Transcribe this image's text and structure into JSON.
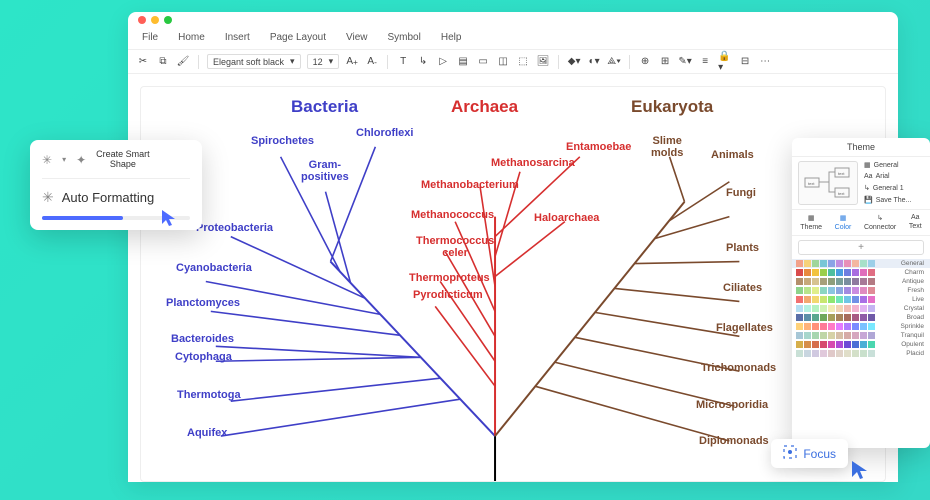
{
  "menus": {
    "file": "File",
    "home": "Home",
    "insert": "Insert",
    "pagelayout": "Page Layout",
    "view": "View",
    "symbol": "Symbol",
    "help": "Help"
  },
  "toolbar": {
    "font_name": "Elegant soft black",
    "font_size": "12"
  },
  "tree": {
    "domains": {
      "bacteria": "Bacteria",
      "archaea": "Archaea",
      "eukaryota": "Eukaryota"
    },
    "bacteria": {
      "spirochetes": "Spirochetes",
      "chloroflexi": "Chloroflexi",
      "gram_positives": "Gram-\npositives",
      "proteobacteria": "Proteobacteria",
      "cyanobacteria": "Cyanobacteria",
      "planctomyces": "Planctomyces",
      "bacteroides": "Bacteroides",
      "cytophaga": "Cytophaga",
      "thermotoga": "Thermotoga",
      "aquifex": "Aquifex"
    },
    "archaea": {
      "methanosarcina": "Methanosarcina",
      "methanobacterium": "Methanobacterium",
      "methanococcus": "Methanococcus",
      "thermococcus": "Thermococcus\nceler",
      "thermoproteus": "Thermoproteus",
      "pyrodicticum": "Pyrodicticum",
      "entamoebae": "Entamoebae",
      "haloarchaea": "Haloarchaea"
    },
    "eukaryota": {
      "slime_molds": "Slime\nmolds",
      "animals": "Animals",
      "fungi": "Fungi",
      "plants": "Plants",
      "ciliates": "Ciliates",
      "flagellates": "Flagellates",
      "trichomonads": "Trichomonads",
      "microsporidia": "Microsporidia",
      "diplomonads": "Diplomonads"
    }
  },
  "popup": {
    "create_smart_shape": "Create Smart\nShape",
    "auto_formatting": "Auto Formatting"
  },
  "theme": {
    "title": "Theme",
    "side": {
      "general": "General",
      "font": "Arial",
      "general1": "General 1",
      "save": "Save The..."
    },
    "tabs": {
      "theme": "Theme",
      "color": "Color",
      "connector": "Connector",
      "text": "Text"
    },
    "palettes": [
      "General",
      "Charm",
      "Antique",
      "Fresh",
      "Live",
      "Crystal",
      "Broad",
      "Sprinkle",
      "Tranquil",
      "Opulent",
      "Placid"
    ],
    "swatches": [
      [
        "#f2a28b",
        "#f6d27a",
        "#9fd69b",
        "#79c6d6",
        "#8aa3e6",
        "#c08ee0",
        "#e88fb8",
        "#f3b6a0",
        "#a7e0c9",
        "#9ccfe8"
      ],
      [
        "#d94b4b",
        "#e8893d",
        "#f2c33d",
        "#9bcf4b",
        "#4fbf9f",
        "#4a9fe0",
        "#6e7fe0",
        "#a96de0",
        "#e06dbb",
        "#e06d83"
      ],
      [
        "#b38f6b",
        "#c7a97a",
        "#d6c28f",
        "#a7a07a",
        "#8f9f7a",
        "#7a9f97",
        "#7a8f9f",
        "#8f7a9f",
        "#a77a97",
        "#b37a83"
      ],
      [
        "#8ed38b",
        "#b8e48b",
        "#e0ee8b",
        "#8bd6c0",
        "#8bc6e0",
        "#8ba7e0",
        "#a38be0",
        "#c98be0",
        "#e08bc0",
        "#e08b97"
      ],
      [
        "#f27070",
        "#f2a970",
        "#f2d870",
        "#c9e670",
        "#8ee670",
        "#70e6b5",
        "#70c6e6",
        "#7090e6",
        "#a970e6",
        "#e670c6"
      ],
      [
        "#b4dff2",
        "#b4f2e2",
        "#b4f2c0",
        "#d0f2b4",
        "#f2ecb4",
        "#f2d4b4",
        "#f2bcb4",
        "#f2b4d0",
        "#e2b4f2",
        "#c4b4f2"
      ],
      [
        "#5a6fa8",
        "#5a8fa8",
        "#5aa88f",
        "#6fa85a",
        "#a8a05a",
        "#a8835a",
        "#a86b5a",
        "#a85a83",
        "#8f5aa8",
        "#6f5aa8"
      ],
      [
        "#ffd27a",
        "#ffb27a",
        "#ff927a",
        "#ff7a97",
        "#ff7ac5",
        "#e57aff",
        "#b27aff",
        "#7a8aff",
        "#7ac2ff",
        "#7ae8ff"
      ],
      [
        "#a7c7d6",
        "#a7d6cc",
        "#a7d6b0",
        "#bfd6a7",
        "#d6d2a7",
        "#d6bfa7",
        "#d6aba7",
        "#d6a7bf",
        "#c7a7d6",
        "#b0a7d6"
      ],
      [
        "#d6af4b",
        "#d68f4b",
        "#d66f4b",
        "#d64b6f",
        "#d64baf",
        "#af4bd6",
        "#6f4bd6",
        "#4b6fd6",
        "#4bafd6",
        "#4bd6af"
      ],
      [
        "#c9e0d6",
        "#c9d6e0",
        "#d0c9e0",
        "#e0c9db",
        "#e0c9c9",
        "#e0d3c9",
        "#e0dec9",
        "#d4e0c9",
        "#c9e0cc",
        "#c9e0d9"
      ]
    ]
  },
  "focus": {
    "label": "Focus"
  }
}
